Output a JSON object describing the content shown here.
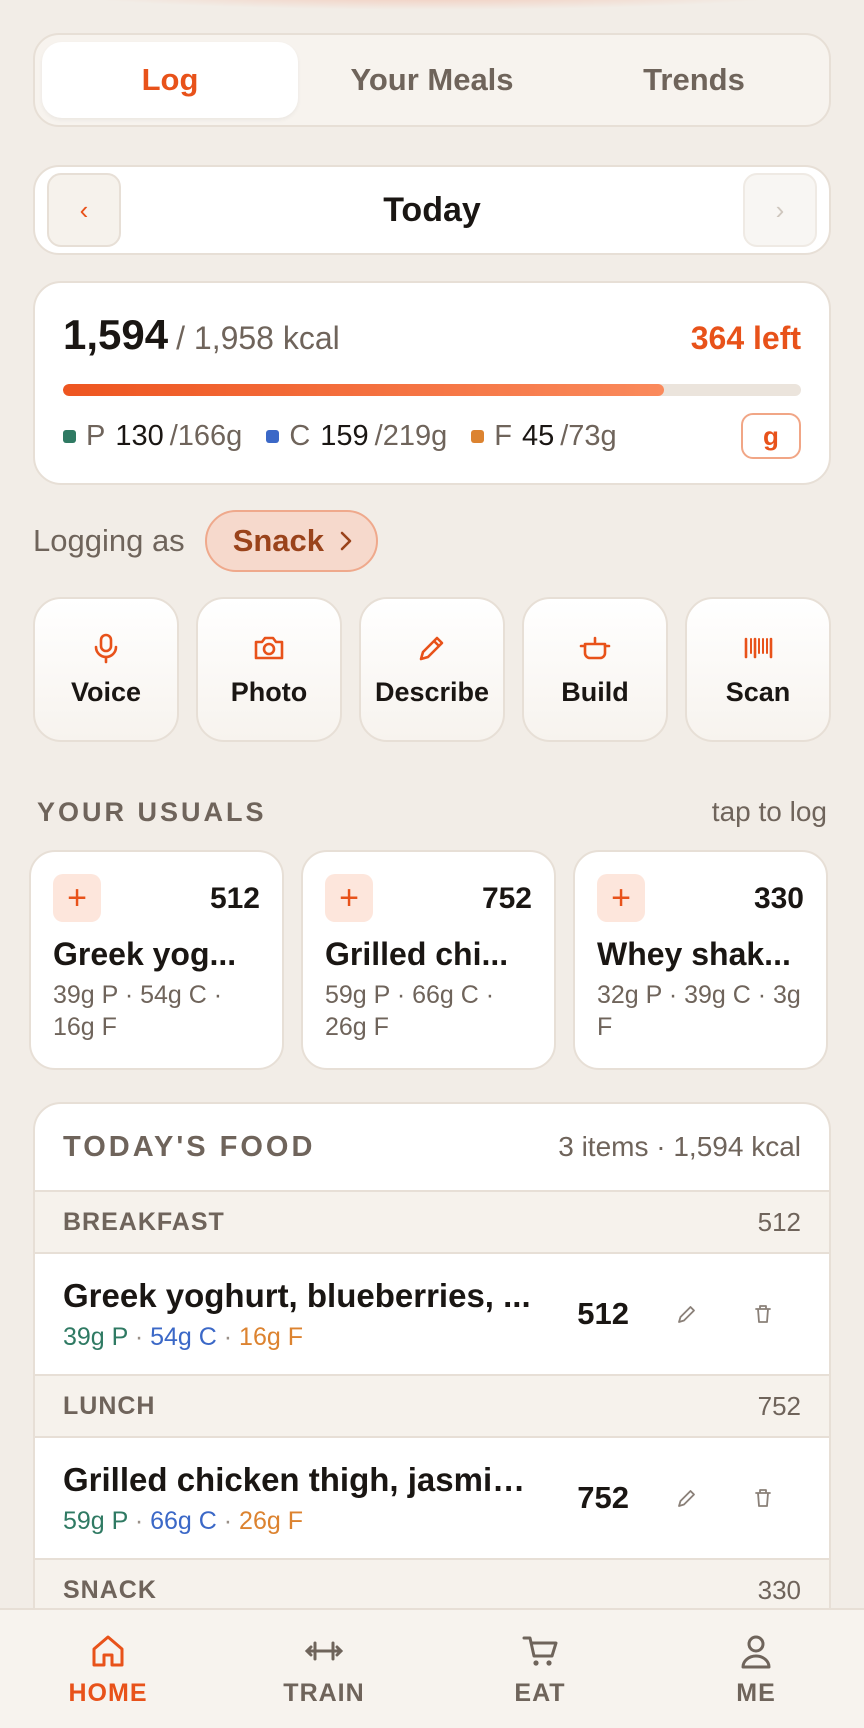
{
  "tabs": [
    "Log",
    "Your Meals",
    "Trends"
  ],
  "active_tab": "Log",
  "date_nav": {
    "prev": "‹",
    "label": "Today",
    "next": "›"
  },
  "calories": {
    "consumed": "1,594",
    "target": "/ 1,958 kcal",
    "left": "364 left",
    "progress_fraction": 0.814
  },
  "macros": [
    {
      "letter": "P",
      "value": "130",
      "target": "/166g",
      "color": "#2f7a63"
    },
    {
      "letter": "C",
      "value": "159",
      "target": "/219g",
      "color": "#3b68c7"
    },
    {
      "letter": "F",
      "value": "45",
      "target": "/73g",
      "color": "#dc8330"
    }
  ],
  "unit_toggle": "g",
  "logging_as": {
    "label": "Logging as",
    "meal": "Snack"
  },
  "actions": [
    {
      "label": "Voice",
      "icon": "microphone-icon"
    },
    {
      "label": "Photo",
      "icon": "camera-icon"
    },
    {
      "label": "Describe",
      "icon": "pencil-icon"
    },
    {
      "label": "Build",
      "icon": "pot-icon"
    },
    {
      "label": "Scan",
      "icon": "barcode-icon"
    }
  ],
  "usuals": {
    "title": "YOUR USUALS",
    "hint": "tap to log",
    "items": [
      {
        "kcal": "512",
        "name": "Greek yog...",
        "macros": "39g P · 54g C · 16g F"
      },
      {
        "kcal": "752",
        "name": "Grilled chi...",
        "macros": "59g P · 66g C · 26g F"
      },
      {
        "kcal": "330",
        "name": "Whey shak...",
        "macros": "32g P · 39g C · 3g F"
      }
    ]
  },
  "todays_food": {
    "title": "TODAY'S FOOD",
    "summary": "3 items · 1,594 kcal",
    "meals": [
      {
        "name": "BREAKFAST",
        "kcal": "512",
        "entries": [
          {
            "name": "Greek yoghurt, blueberries, ...",
            "p": "39g P",
            "c": "54g C",
            "f": "16g F",
            "kcal": "512"
          }
        ]
      },
      {
        "name": "LUNCH",
        "kcal": "752",
        "entries": [
          {
            "name": "Grilled chicken thigh, jasmin...",
            "p": "59g P",
            "c": "66g C",
            "f": "26g F",
            "kcal": "752"
          }
        ]
      },
      {
        "name": "SNACK",
        "kcal": "330",
        "entries": []
      }
    ]
  },
  "bottom_nav": [
    {
      "label": "HOME",
      "icon": "home-icon",
      "active": true
    },
    {
      "label": "TRAIN",
      "icon": "dumbbell-icon",
      "active": false
    },
    {
      "label": "EAT",
      "icon": "cart-icon",
      "active": false
    },
    {
      "label": "ME",
      "icon": "user-icon",
      "active": false
    }
  ]
}
